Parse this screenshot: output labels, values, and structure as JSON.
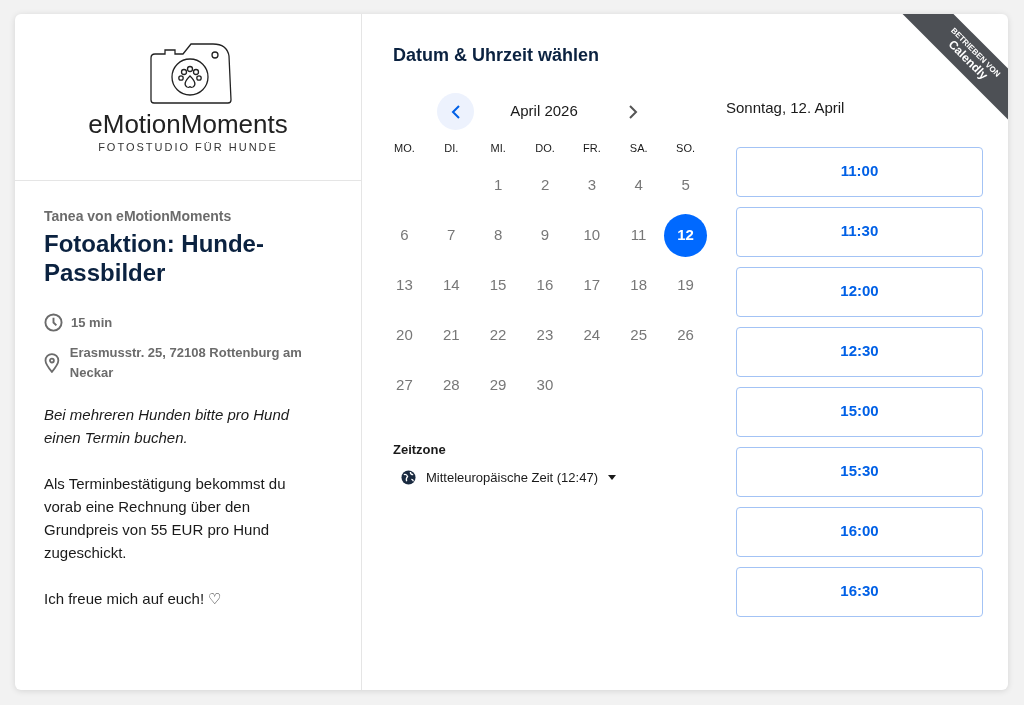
{
  "logo": {
    "name": "eMotionMoments",
    "tagline": "FOTOSTUDIO FÜR HUNDE"
  },
  "event": {
    "host": "Tanea von eMotionMoments",
    "title": "Fotoaktion: Hunde-Passbilder",
    "duration": "15 min",
    "location": "Erasmusstr. 25, 72108 Rottenburg am Neckar",
    "description": [
      {
        "text": "Bei mehreren Hunden bitte pro Hund einen Termin buchen.",
        "italic": true
      },
      {
        "text": "Als Terminbestätigung bekommst du vorab eine Rechnung über den Grundpreis von 55 EUR pro Hund zugeschickt.",
        "italic": false
      },
      {
        "text": "Ich freue mich auf euch! ♡",
        "italic": false
      }
    ]
  },
  "heading": "Datum & Uhrzeit wählen",
  "ribbon": {
    "small": "BETRIEBEN VON",
    "brand": "Calendly"
  },
  "calendar": {
    "month": "April 2026",
    "weekdays": [
      "MO.",
      "DI.",
      "MI.",
      "DO.",
      "FR.",
      "SA.",
      "SO."
    ],
    "weeks": [
      {
        "starts_mid_week": true,
        "days": [
          {
            "day": "1",
            "selected": false
          },
          {
            "day": "2",
            "selected": false
          },
          {
            "day": "3",
            "selected": false
          },
          {
            "day": "4",
            "selected": false
          },
          {
            "day": "5",
            "selected": false
          }
        ]
      },
      {
        "starts_mid_week": false,
        "days": [
          {
            "day": "6",
            "selected": false
          },
          {
            "day": "7",
            "selected": false
          },
          {
            "day": "8",
            "selected": false
          },
          {
            "day": "9",
            "selected": false
          },
          {
            "day": "10",
            "selected": false
          },
          {
            "day": "11",
            "selected": false
          },
          {
            "day": "12",
            "selected": true
          }
        ]
      },
      {
        "starts_mid_week": false,
        "days": [
          {
            "day": "13",
            "selected": false
          },
          {
            "day": "14",
            "selected": false
          },
          {
            "day": "15",
            "selected": false
          },
          {
            "day": "16",
            "selected": false
          },
          {
            "day": "17",
            "selected": false
          },
          {
            "day": "18",
            "selected": false
          },
          {
            "day": "19",
            "selected": false
          }
        ]
      },
      {
        "starts_mid_week": false,
        "days": [
          {
            "day": "20",
            "selected": false
          },
          {
            "day": "21",
            "selected": false
          },
          {
            "day": "22",
            "selected": false
          },
          {
            "day": "23",
            "selected": false
          },
          {
            "day": "24",
            "selected": false
          },
          {
            "day": "25",
            "selected": false
          },
          {
            "day": "26",
            "selected": false
          }
        ]
      },
      {
        "starts_mid_week": false,
        "days": [
          {
            "day": "27",
            "selected": false
          },
          {
            "day": "28",
            "selected": false
          },
          {
            "day": "29",
            "selected": false
          },
          {
            "day": "30",
            "selected": false
          }
        ]
      }
    ]
  },
  "timezone": {
    "label": "Zeitzone",
    "value": "Mitteleuropäische Zeit (12:47)"
  },
  "selected_date": "Sonntag, 12. April",
  "slots": [
    "11:00",
    "11:30",
    "12:00",
    "12:30",
    "15:00",
    "15:30",
    "16:00",
    "16:30"
  ]
}
